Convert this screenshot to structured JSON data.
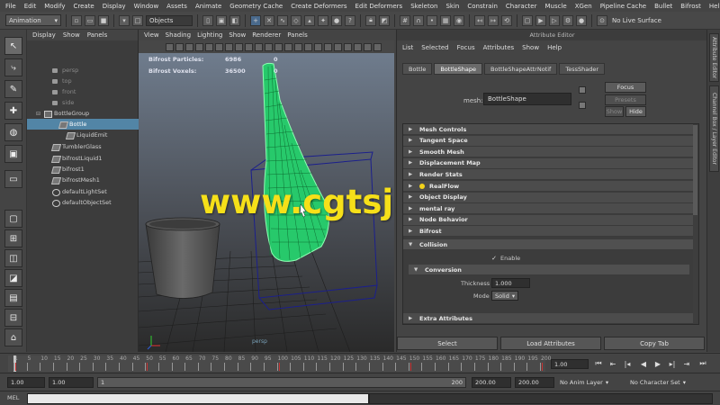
{
  "menubar": [
    "File",
    "Edit",
    "Modify",
    "Create",
    "Display",
    "Window",
    "Assets",
    "Animate",
    "Geometry Cache",
    "Create Deformers",
    "Edit Deformers",
    "Skeleton",
    "Skin",
    "Constrain",
    "Character",
    "Muscle",
    "XGen",
    "Pipeline Cache",
    "Bullet",
    "Bifrost",
    "Help"
  ],
  "statusline": {
    "mode": "Animation",
    "objects_label": "Objects",
    "live_surface": "No Live Surface"
  },
  "outliner": {
    "menu": [
      "Display",
      "Show",
      "Panels"
    ],
    "items": [
      {
        "label": "persp",
        "dim": true,
        "icon": "camera-icon"
      },
      {
        "label": "top",
        "dim": true,
        "icon": "camera-icon"
      },
      {
        "label": "front",
        "dim": true,
        "icon": "camera-icon"
      },
      {
        "label": "side",
        "dim": true,
        "icon": "camera-icon"
      },
      {
        "label": "BottleGroup",
        "icon": "group-icon"
      },
      {
        "label": "Bottle",
        "icon": "mesh-icon",
        "selected": true
      },
      {
        "label": "LiquidEmit",
        "icon": "mesh-icon"
      },
      {
        "label": "TumblerGlass",
        "icon": "mesh-icon"
      },
      {
        "label": "bifrostLiquid1",
        "icon": "mesh-icon"
      },
      {
        "label": "bifrost1",
        "icon": "mesh-icon"
      },
      {
        "label": "bifrostMesh1",
        "icon": "mesh-icon"
      },
      {
        "label": "defaultLightSet",
        "icon": "set-icon"
      },
      {
        "label": "defaultObjectSet",
        "icon": "set-icon"
      }
    ]
  },
  "viewport": {
    "menu": [
      "View",
      "Shading",
      "Lighting",
      "Show",
      "Renderer",
      "Panels"
    ],
    "hud": [
      {
        "label": "Bifrost Particles:",
        "value": "6986",
        "extra": "0"
      },
      {
        "label": "Bifrost Voxels:",
        "value": "36500",
        "extra": "0"
      }
    ],
    "camera": "persp",
    "watermark": "www.cgtsj.com"
  },
  "attribute_editor": {
    "title": "Attribute Editor",
    "menu": [
      "List",
      "Selected",
      "Focus",
      "Attributes",
      "Show",
      "Help"
    ],
    "tabs": [
      "Bottle",
      "BottleShape",
      "BottleShapeAttrNotif",
      "TessShader"
    ],
    "active_tab": 1,
    "mesh_label": "mesh:",
    "mesh_value": "BottleShape",
    "buttons": {
      "focus": "Focus",
      "presets": "Presets",
      "show": "Show",
      "hide": "Hide"
    },
    "sections": [
      "Mesh Controls",
      "Tangent Space",
      "Smooth Mesh",
      "Displacement Map",
      "Render Stats",
      "RealFlow",
      "Object Display",
      "mental ray",
      "Node Behavior",
      "Bifrost"
    ],
    "collision": {
      "title": "Collision",
      "enable_label": "Enable",
      "enable_checked": "✓"
    },
    "conversion": {
      "title": "Conversion",
      "thickness_label": "Thickness",
      "thickness_value": "1.000",
      "mode_label": "Mode",
      "mode_value": "Solid"
    },
    "extra": "Extra Attributes",
    "bottom_buttons": [
      "Select",
      "Load Attributes",
      "Copy Tab"
    ]
  },
  "side_tabs": [
    "Attribute Editor",
    "Channel Box / Layer Editor"
  ],
  "timeslider": {
    "ticks": [
      "1",
      "5",
      "10",
      "15",
      "20",
      "25",
      "30",
      "35",
      "40",
      "45",
      "50",
      "55",
      "60",
      "65",
      "70",
      "75",
      "80",
      "85",
      "90",
      "95",
      "100",
      "105",
      "110",
      "115",
      "120",
      "125",
      "130",
      "135",
      "140",
      "145",
      "150",
      "155",
      "160",
      "165",
      "170",
      "175",
      "180",
      "185",
      "190",
      "195",
      "200"
    ],
    "current_frame": "1.00"
  },
  "rangeslider": {
    "start": "1.00",
    "playback_start": "1.00",
    "bar_start": "1",
    "bar_end": "200",
    "playback_end": "200.00",
    "end": "200.00",
    "anim_layer": "No Anim Layer",
    "char_set": "No Character Set"
  },
  "cmdline": {
    "label": "MEL"
  }
}
